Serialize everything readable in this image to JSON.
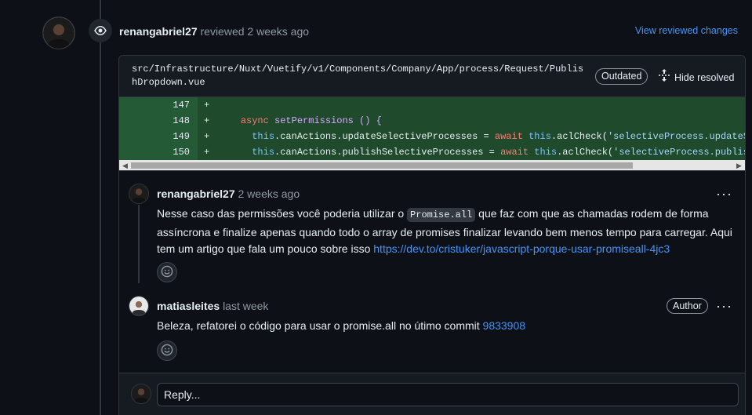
{
  "review": {
    "user": "renangabriel27",
    "action": "reviewed",
    "time": "2 weeks ago",
    "view_changes": "View reviewed changes"
  },
  "file": {
    "path": "src/Infrastructure/Nuxt/Vuetify/v1/Components/Company/App/process/Request/PublishDropdown.vue",
    "outdated_label": "Outdated",
    "hide_resolved_label": "Hide resolved"
  },
  "diff": {
    "lines": [
      {
        "num": "147",
        "sign": "+"
      },
      {
        "num": "148",
        "sign": "+"
      },
      {
        "num": "149",
        "sign": "+"
      },
      {
        "num": "150",
        "sign": "+"
      }
    ],
    "code": {
      "l148_kw": "async",
      "l148_fn": "setPermissions () {",
      "l149_this": "this",
      "l149_mid": ".canActions.updateSelectiveProcesses = ",
      "l149_await": "await",
      "l149_this2": "this",
      "l149_call": ".aclCheck(",
      "l149_str": "'selectiveProcess.updateS",
      "l150_this": "this",
      "l150_mid": ".canActions.publishSelectiveProcesses = ",
      "l150_await": "await",
      "l150_this2": "this",
      "l150_call": ".aclCheck(",
      "l150_str": "'selectiveProcess.publis"
    }
  },
  "comments": [
    {
      "user": "renangabriel27",
      "time": "2 weeks ago",
      "text_before": "Nesse caso das permissões você poderia utilizar o ",
      "code": "Promise.all",
      "text_after": " que faz com que as chamadas rodem de forma assíncrona e finalize apenas quando todo o array de promises finalizar levando bem menos tempo para carregar. Aqui tem um artigo que fala um pouco sobre isso ",
      "link": "https://dev.to/cristuker/javascript-porque-usar-promiseall-4jc3"
    },
    {
      "user": "matiasleites",
      "time": "last week",
      "badge": "Author",
      "text_before": "Beleza, refatorei o código para usar o promise.all no útimo commit ",
      "link": "9833908"
    }
  ],
  "reply": {
    "placeholder": "Reply..."
  },
  "icons": {
    "review": "eye-icon",
    "hide": "unfold-icon",
    "menu": "kebab-horizontal-icon",
    "reaction": "smiley-icon"
  },
  "colors": {
    "background": "#0d1117",
    "link": "#4493f8",
    "addition_bg": "#1f4a2b"
  }
}
